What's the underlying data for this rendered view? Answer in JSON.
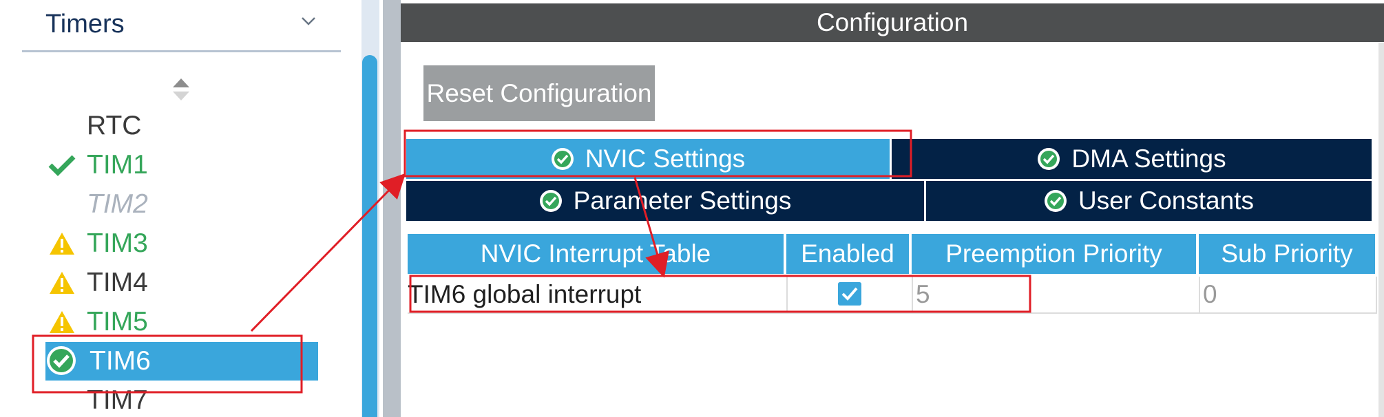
{
  "sidebar": {
    "category": "Timers",
    "items": [
      {
        "label": "RTC",
        "state": "normal",
        "icon": ""
      },
      {
        "label": "TIM1",
        "state": "green",
        "icon": "check-icon"
      },
      {
        "label": "TIM2",
        "state": "disabled",
        "icon": ""
      },
      {
        "label": "TIM3",
        "state": "green",
        "icon": "warning-icon"
      },
      {
        "label": "TIM4",
        "state": "normal",
        "icon": "warning-icon"
      },
      {
        "label": "TIM5",
        "state": "green",
        "icon": "warning-icon"
      },
      {
        "label": "TIM6",
        "state": "selected",
        "icon": "check-circle-icon"
      },
      {
        "label": "TIM7",
        "state": "normal",
        "icon": ""
      }
    ]
  },
  "config": {
    "title": "Configuration",
    "reset_label": "Reset Configuration",
    "tabs": {
      "nvic": "NVIC Settings",
      "dma": "DMA Settings",
      "param": "Parameter Settings",
      "user": "User Constants"
    },
    "table": {
      "headers": [
        "NVIC Interrupt Table",
        "Enabled",
        "Preemption Priority",
        "Sub Priority"
      ],
      "rows": [
        {
          "name": "TIM6 global interrupt",
          "enabled": true,
          "preemption": "5",
          "sub": "0"
        }
      ]
    }
  },
  "colors": {
    "accent": "#3aa6dc",
    "tab_inactive": "#032246",
    "header_bar": "#4d4f50",
    "highlight_red": "#e01e26",
    "ok_green": "#35a65a",
    "warning_yellow": "#f5c400"
  }
}
